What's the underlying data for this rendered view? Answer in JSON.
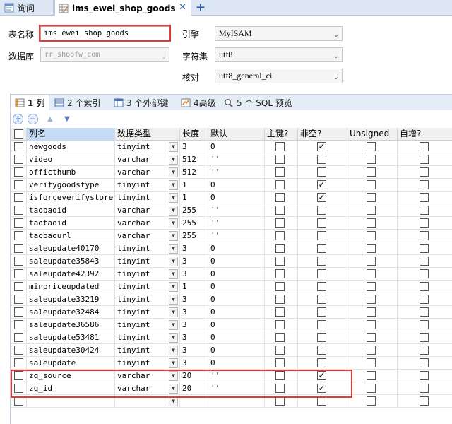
{
  "tabs": [
    {
      "label": "询问",
      "active": false
    },
    {
      "label": "ims_ewei_shop_goods",
      "active": true
    }
  ],
  "icons": {
    "close": "close-icon",
    "add": "plus-icon"
  },
  "form": {
    "table_name_label": "表名称",
    "table_name_value": "ims_ewei_shop_goods",
    "database_label": "数据库",
    "database_value": "rr_shopfw_com",
    "engine_label": "引擎",
    "engine_value": "MyISAM",
    "charset_label": "字符集",
    "charset_value": "utf8",
    "collation_label": "核对",
    "collation_value": "utf8_general_ci"
  },
  "subtabs": [
    {
      "label": "1 列",
      "active": true
    },
    {
      "label": "2 个索引",
      "active": false
    },
    {
      "label": "3 个外部键",
      "active": false
    },
    {
      "label": "4高级",
      "active": false
    },
    {
      "label": "5 个 SQL 预览",
      "active": false
    }
  ],
  "columns": [
    "列名",
    "数据类型",
    "长度",
    "默认",
    "主键?",
    "非空?",
    "Unsigned",
    "自增?"
  ],
  "rows": [
    {
      "name": "newgoods",
      "type": "tinyint",
      "length": "3",
      "default": "0",
      "pk": false,
      "notnull": true,
      "unsigned": false,
      "autoinc": false
    },
    {
      "name": "video",
      "type": "varchar",
      "length": "512",
      "default": "''",
      "pk": false,
      "notnull": false,
      "unsigned": false,
      "autoinc": false
    },
    {
      "name": "officthumb",
      "type": "varchar",
      "length": "512",
      "default": "''",
      "pk": false,
      "notnull": false,
      "unsigned": false,
      "autoinc": false
    },
    {
      "name": "verifygoodstype",
      "type": "tinyint",
      "length": "1",
      "default": "0",
      "pk": false,
      "notnull": true,
      "unsigned": false,
      "autoinc": false
    },
    {
      "name": "isforceverifystore",
      "type": "tinyint",
      "length": "1",
      "default": "0",
      "pk": false,
      "notnull": true,
      "unsigned": false,
      "autoinc": false
    },
    {
      "name": "taobaoid",
      "type": "varchar",
      "length": "255",
      "default": "''",
      "pk": false,
      "notnull": false,
      "unsigned": false,
      "autoinc": false
    },
    {
      "name": "taotaoid",
      "type": "varchar",
      "length": "255",
      "default": "''",
      "pk": false,
      "notnull": false,
      "unsigned": false,
      "autoinc": false
    },
    {
      "name": "taobaourl",
      "type": "varchar",
      "length": "255",
      "default": "''",
      "pk": false,
      "notnull": false,
      "unsigned": false,
      "autoinc": false
    },
    {
      "name": "saleupdate40170",
      "type": "tinyint",
      "length": "3",
      "default": "0",
      "pk": false,
      "notnull": false,
      "unsigned": false,
      "autoinc": false
    },
    {
      "name": "saleupdate35843",
      "type": "tinyint",
      "length": "3",
      "default": "0",
      "pk": false,
      "notnull": false,
      "unsigned": false,
      "autoinc": false
    },
    {
      "name": "saleupdate42392",
      "type": "tinyint",
      "length": "3",
      "default": "0",
      "pk": false,
      "notnull": false,
      "unsigned": false,
      "autoinc": false
    },
    {
      "name": "minpriceupdated",
      "type": "tinyint",
      "length": "1",
      "default": "0",
      "pk": false,
      "notnull": false,
      "unsigned": false,
      "autoinc": false
    },
    {
      "name": "saleupdate33219",
      "type": "tinyint",
      "length": "3",
      "default": "0",
      "pk": false,
      "notnull": false,
      "unsigned": false,
      "autoinc": false
    },
    {
      "name": "saleupdate32484",
      "type": "tinyint",
      "length": "3",
      "default": "0",
      "pk": false,
      "notnull": false,
      "unsigned": false,
      "autoinc": false
    },
    {
      "name": "saleupdate36586",
      "type": "tinyint",
      "length": "3",
      "default": "0",
      "pk": false,
      "notnull": false,
      "unsigned": false,
      "autoinc": false
    },
    {
      "name": "saleupdate53481",
      "type": "tinyint",
      "length": "3",
      "default": "0",
      "pk": false,
      "notnull": false,
      "unsigned": false,
      "autoinc": false
    },
    {
      "name": "saleupdate30424",
      "type": "tinyint",
      "length": "3",
      "default": "0",
      "pk": false,
      "notnull": false,
      "unsigned": false,
      "autoinc": false
    },
    {
      "name": "saleupdate",
      "type": "tinyint",
      "length": "3",
      "default": "0",
      "pk": false,
      "notnull": false,
      "unsigned": false,
      "autoinc": false
    },
    {
      "name": "zq_source",
      "type": "varchar",
      "length": "20",
      "default": "''",
      "pk": false,
      "notnull": true,
      "unsigned": false,
      "autoinc": false
    },
    {
      "name": "zq_id",
      "type": "varchar",
      "length": "20",
      "default": "''",
      "pk": false,
      "notnull": true,
      "unsigned": false,
      "autoinc": false
    },
    {
      "name": "",
      "type": "",
      "length": "",
      "default": "",
      "pk": false,
      "notnull": false,
      "unsigned": false,
      "autoinc": false
    }
  ],
  "colors": {
    "highlight": "#e53935",
    "tabbar": "#dde6f3",
    "header_selected": "#c5daf5"
  }
}
